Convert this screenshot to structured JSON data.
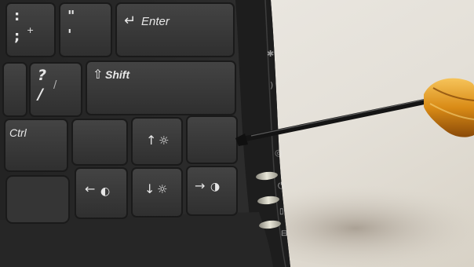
{
  "keys": {
    "enter": "Enter",
    "shift": "Shift",
    "ctrl": "Ctrl",
    "semicolon_top": ":",
    "semicolon_bottom": ";",
    "quote_top": "\"",
    "quote_bottom": "'",
    "slash_top": "?",
    "slash_bottom": "/"
  },
  "colors": {
    "wall": "#e7e3dc",
    "keyboard_body": "#2a2a2a",
    "key_face": "#3b3b3b",
    "screwdriver_handle": "#d9901f"
  }
}
